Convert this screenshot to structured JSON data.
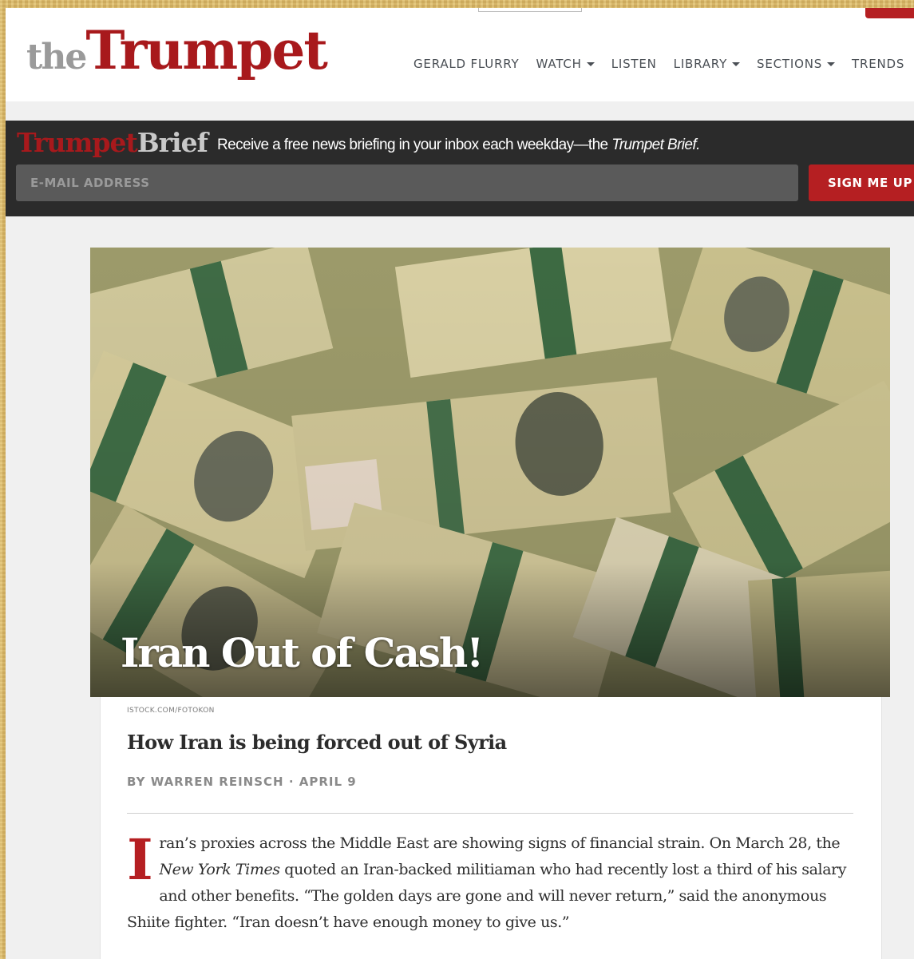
{
  "header": {
    "logo_the": "the",
    "logo_trumpet": "Trumpet",
    "nav": [
      {
        "label": "GERALD FLURRY",
        "has_dropdown": false
      },
      {
        "label": "WATCH",
        "has_dropdown": true
      },
      {
        "label": "LISTEN",
        "has_dropdown": false
      },
      {
        "label": "LIBRARY",
        "has_dropdown": true
      },
      {
        "label": "SECTIONS",
        "has_dropdown": true
      },
      {
        "label": "TRENDS",
        "has_dropdown": false
      }
    ]
  },
  "brief": {
    "logo_trumpet": "Trumpet",
    "logo_brief": "Brief",
    "text_before": "Receive a free news briefing in your inbox each weekday—the ",
    "text_italic": "Trumpet Brief.",
    "email_placeholder": "E-MAIL ADDRESS",
    "button_label": "SIGN ME UP"
  },
  "hero": {
    "title": "Iran Out of Cash!"
  },
  "article": {
    "photo_credit": "ISTOCK.COM/FOTOKON",
    "subtitle": "How Iran is being forced out of Syria",
    "byline": "BY WARREN REINSCH · APRIL 9",
    "dropcap": "I",
    "body_part1": "ran’s proxies across the Middle East are showing signs of financial strain. On March 28, the ",
    "body_italic": "New York Times",
    "body_part2": " quoted an Iran-backed militiaman who had recently lost a third of his salary and other benefits. “The golden days are gone and will never return,” said the anonymous Shiite fighter. “Iran doesn’t have enough money to give us.”"
  },
  "colors": {
    "brand_red": "#a8191c",
    "button_red": "#b51f22",
    "brief_bg": "#2b2b2b",
    "page_border": "#d9b96a"
  }
}
